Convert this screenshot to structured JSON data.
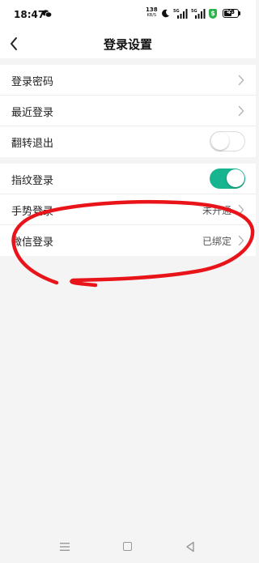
{
  "status_bar": {
    "time": "18:47",
    "net_speed": "138",
    "net_unit": "KB/S",
    "signal_1": "5G",
    "signal_2": "5G",
    "battery": "48"
  },
  "header": {
    "title": "登录设置"
  },
  "group_1": [
    {
      "label": "登录密码",
      "control": "chevron"
    },
    {
      "label": "最近登录",
      "control": "chevron"
    },
    {
      "label": "翻转退出",
      "control": "toggle",
      "state": "off"
    }
  ],
  "group_2": [
    {
      "label": "指纹登录",
      "control": "toggle",
      "state": "on"
    },
    {
      "label": "手势登录",
      "value": "未开通",
      "control": "chevron"
    },
    {
      "label": "微信登录",
      "value": "已绑定",
      "control": "chevron"
    }
  ],
  "colors": {
    "accent": "#17b58f",
    "annotation": "#e8141a"
  },
  "icons": {
    "back": "chevron-left-icon",
    "row_arrow": "chevron-right-icon",
    "nav_menu": "menu-icon",
    "nav_home": "home-square-icon",
    "nav_back": "back-triangle-icon"
  }
}
